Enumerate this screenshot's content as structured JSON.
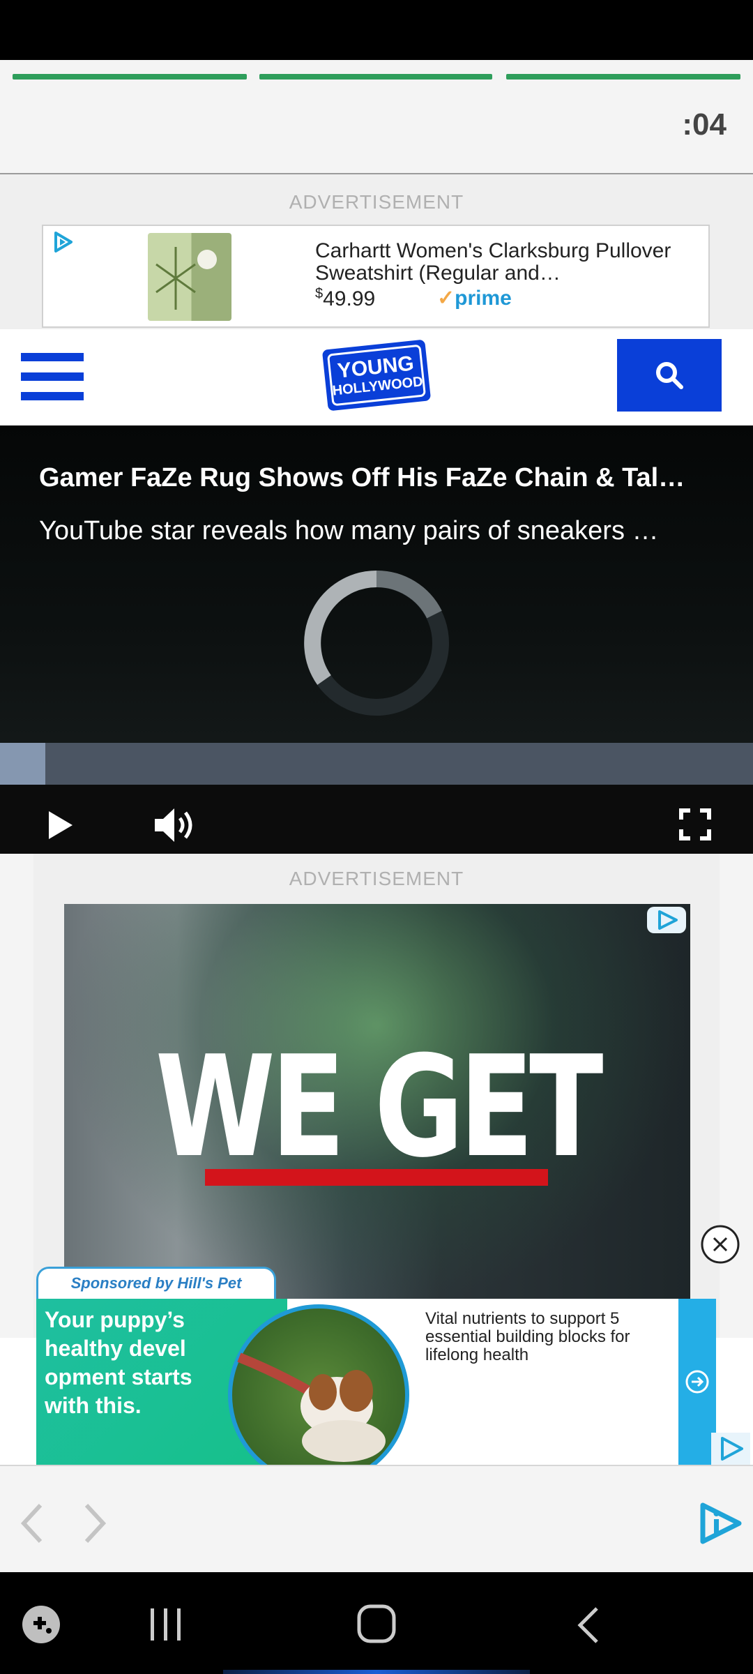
{
  "story": {
    "timer": ":04",
    "segments": 3
  },
  "ad_top": {
    "label": "ADVERTISEMENT",
    "title": "Carhartt Women's Clarksburg Pullover Sweatshirt (Regular and…",
    "price_currency": "$",
    "price_value": "49.99",
    "prime_label": "prime"
  },
  "header": {
    "logo_line1": "YOUNG",
    "logo_line2": "HOLLYWOOD"
  },
  "video": {
    "title": "Gamer FaZe Rug Shows Off His FaZe Chain & Tal…",
    "subtitle": "YouTube star reveals how many pairs of sneakers …",
    "progress": 0.06
  },
  "ad_mid": {
    "label": "ADVERTISEMENT",
    "headline": "WE GET"
  },
  "sponsored": {
    "tab": "Sponsored by Hill's Pet",
    "headline": "Your puppy’s healthy devel opment starts with this.",
    "copy": "Vital nutrients to support 5 essential building blocks for lifelong health"
  },
  "colors": {
    "brand_blue": "#0a3fd8",
    "story_green": "#2e9e5b",
    "sponsor_green": "#16c08a",
    "accent_cyan": "#24aee6",
    "red_bar": "#d3141b"
  },
  "icons": [
    "adchoices-icon",
    "menu-icon",
    "search-icon",
    "spinner-icon",
    "play-icon",
    "volume-icon",
    "fullscreen-icon",
    "close-icon",
    "arrow-right-icon",
    "back-icon",
    "forward-icon",
    "game-launcher-icon",
    "recents-icon",
    "home-icon",
    "nav-back-icon"
  ]
}
